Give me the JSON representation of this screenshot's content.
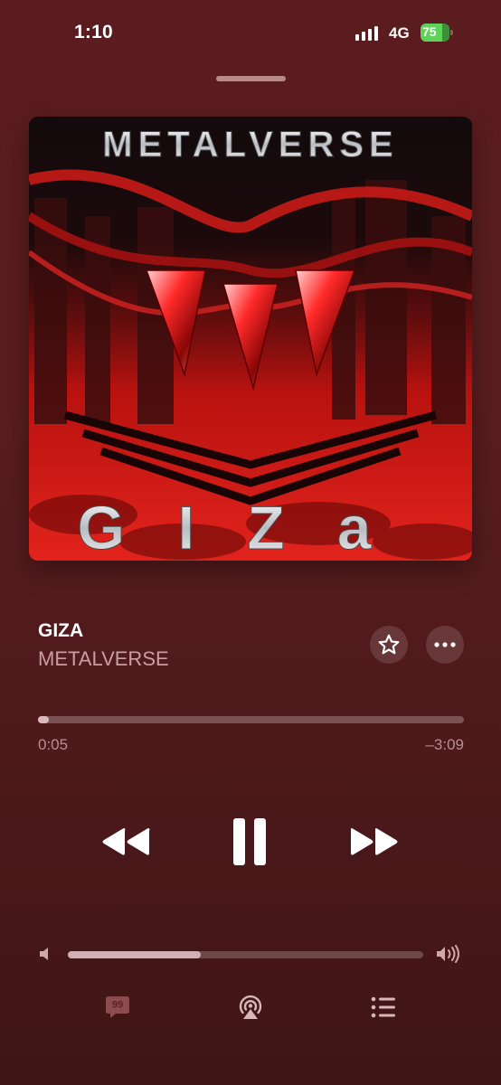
{
  "status_bar": {
    "time": "1:10",
    "network": "4G",
    "battery_percent": "75"
  },
  "artwork": {
    "top_text": "METALVERSE",
    "bottom_text": "GIZa"
  },
  "track": {
    "title": "GIZA",
    "artist": "METALVERSE"
  },
  "playback": {
    "elapsed": "0:05",
    "remaining": "–3:09",
    "progress": 0.026
  },
  "volume": {
    "level": 0.375
  },
  "controls": {
    "icons": [
      "star-icon",
      "more-icon",
      "rewind-icon",
      "pause-icon",
      "forward-icon",
      "volume-low-icon",
      "volume-high-icon",
      "lyrics-icon",
      "airplay-icon",
      "queue-icon"
    ]
  },
  "colors": {
    "background": "#5a1c1e",
    "accent_red": "#d8251f",
    "battery_green": "#5ed35a",
    "secondary_text": "#c99ea0"
  }
}
